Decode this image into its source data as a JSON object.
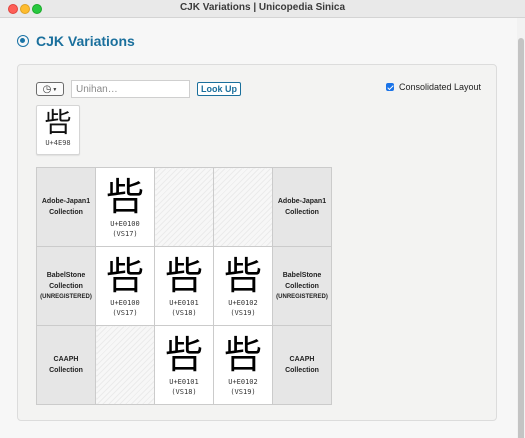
{
  "window": {
    "title": "CJK Variations | Unicopedia Sinica"
  },
  "header": {
    "title": "CJK Variations"
  },
  "toolbar": {
    "history_icon": "history-clock-icon",
    "search_placeholder": "Unihan…",
    "search_value": "",
    "lookup_label": "Look Up",
    "consolidated_label": "Consolidated Layout",
    "consolidated_checked": true
  },
  "base": {
    "character": "呰",
    "code": "U+4E98"
  },
  "rows": [
    {
      "label": "Adobe-Japan1",
      "label2": "Collection",
      "sub": "",
      "cells": [
        {
          "glyph": "呰",
          "code": "U+E0100",
          "vs": "(VS17)"
        },
        null,
        null
      ]
    },
    {
      "label": "BabelStone",
      "label2": "Collection",
      "sub": "(UNREGISTERED)",
      "cells": [
        {
          "glyph": "呰",
          "code": "U+E0100",
          "vs": "(VS17)"
        },
        {
          "glyph": "呰",
          "code": "U+E0101",
          "vs": "(VS18)"
        },
        {
          "glyph": "呰",
          "code": "U+E0102",
          "vs": "(VS19)"
        }
      ]
    },
    {
      "label": "CAAPH",
      "label2": "Collection",
      "sub": "",
      "cells": [
        null,
        {
          "glyph": "呰",
          "code": "U+E0101",
          "vs": "(VS18)"
        },
        {
          "glyph": "呰",
          "code": "U+E0102",
          "vs": "(VS19)"
        }
      ]
    }
  ],
  "colors": {
    "accent": "#1a6f9c",
    "checkbox": "#1a73e8"
  }
}
